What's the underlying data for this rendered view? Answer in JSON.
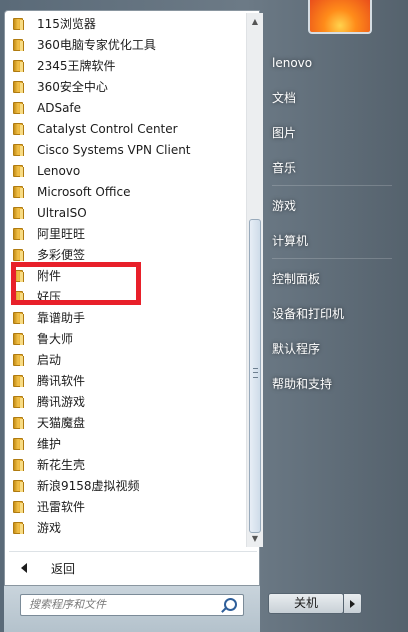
{
  "programs": [
    {
      "label": "115浏览器"
    },
    {
      "label": "360电脑专家优化工具"
    },
    {
      "label": "2345王牌软件"
    },
    {
      "label": "360安全中心"
    },
    {
      "label": "ADSafe"
    },
    {
      "label": "Catalyst Control Center"
    },
    {
      "label": "Cisco Systems VPN Client"
    },
    {
      "label": "Lenovo"
    },
    {
      "label": "Microsoft Office"
    },
    {
      "label": "UltraISO"
    },
    {
      "label": "阿里旺旺"
    },
    {
      "label": "多彩便签"
    },
    {
      "label": "附件"
    },
    {
      "label": "好压"
    },
    {
      "label": "靠谱助手"
    },
    {
      "label": "鲁大师"
    },
    {
      "label": "启动"
    },
    {
      "label": "腾讯软件"
    },
    {
      "label": "腾讯游戏"
    },
    {
      "label": "天猫魔盘"
    },
    {
      "label": "维护"
    },
    {
      "label": "新花生壳"
    },
    {
      "label": "新浪9158虚拟视频"
    },
    {
      "label": "迅雷软件"
    },
    {
      "label": "游戏"
    }
  ],
  "highlighted_item": "附件",
  "back_label": "返回",
  "search": {
    "placeholder": "搜索程序和文件"
  },
  "right_menu": {
    "username": "lenovo",
    "documents": "文档",
    "pictures": "图片",
    "music": "音乐",
    "games": "游戏",
    "computer": "计算机",
    "control_panel": "控制面板",
    "devices_printers": "设备和打印机",
    "default_programs": "默认程序",
    "help_support": "帮助和支持"
  },
  "shutdown_label": "关机",
  "colors": {
    "highlight_border": "#e8202a",
    "folder": "#f2c14a"
  }
}
